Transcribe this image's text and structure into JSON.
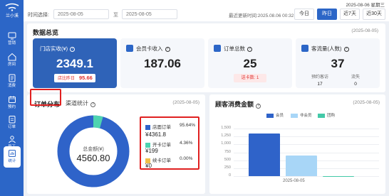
{
  "app": {
    "logo_text": "兰小溪"
  },
  "sidebar": {
    "items": [
      {
        "label": "营销",
        "icon": "monitor-icon"
      },
      {
        "label": "房间",
        "icon": "home-icon"
      },
      {
        "label": "消费",
        "icon": "receipt-icon"
      },
      {
        "label": "预约",
        "icon": "calendar-icon"
      },
      {
        "label": "订单",
        "icon": "order-icon"
      },
      {
        "label": "员工",
        "icon": "staff-icon"
      },
      {
        "label": "统计",
        "icon": "stats-icon"
      }
    ]
  },
  "topbar": {
    "date_weekday": "2025-08-06 星期三",
    "filter_label": "时间选择:",
    "date_start": "2025-08-05",
    "date_sep": "至",
    "date_end": "2025-08-05",
    "update_time": "最近更新时间:2025.08.06 00:32",
    "ranges": [
      "今日",
      "昨日",
      "近7天",
      "近30天"
    ],
    "active_range": "昨日"
  },
  "overview": {
    "title": "数据总览",
    "date": "(2025-08-05)",
    "kpis": [
      {
        "label": "门店实收(¥)",
        "value": "2349.1",
        "compare_label": "店比昨日",
        "compare_value": "95.66"
      },
      {
        "label": "会员卡收入",
        "value": "187.06"
      },
      {
        "label": "订单总数",
        "value": "25",
        "compare_text": "送卡数: 1"
      },
      {
        "label": "客流量(人数)",
        "value": "37",
        "sub": [
          {
            "label": "预约客访",
            "value": "17"
          },
          {
            "label": "流失",
            "value": "0"
          }
        ]
      }
    ]
  },
  "order_panel": {
    "title": "订单分布",
    "tab": "渠道统计",
    "date": "(2025-08-05)",
    "total_label": "总金额(¥)",
    "total_value": "4560.80",
    "legend": [
      {
        "name": "店面订单",
        "percent": "95.64%",
        "amount": "¥4361.8",
        "color": "#2f63c9"
      },
      {
        "name": "开卡订单",
        "percent": "4.36%",
        "amount": "¥199",
        "color": "#4ed3b0"
      },
      {
        "name": "续卡订单",
        "percent": "0.00%",
        "amount": "¥0",
        "color": "#f0c04a"
      }
    ]
  },
  "consumption_panel": {
    "title": "顾客消费金额",
    "date": "(2025-08-05)"
  },
  "chart_data": {
    "type": "bar",
    "categories": [
      "2025-08-05"
    ],
    "series": [
      {
        "name": "会员",
        "values": [
          1600
        ],
        "color": "#2f63c9"
      },
      {
        "name": "非会员",
        "values": [
          780
        ],
        "color": "#a8d6f7"
      },
      {
        "name": "团购",
        "values": [
          0
        ],
        "color": "#43c9a8"
      }
    ],
    "yticks": [
      "1,500",
      "1,250",
      "1,000",
      "750",
      "500",
      "250",
      "0"
    ],
    "ylim": [
      0,
      1750
    ],
    "grid": true,
    "legend_position": "top-center"
  }
}
